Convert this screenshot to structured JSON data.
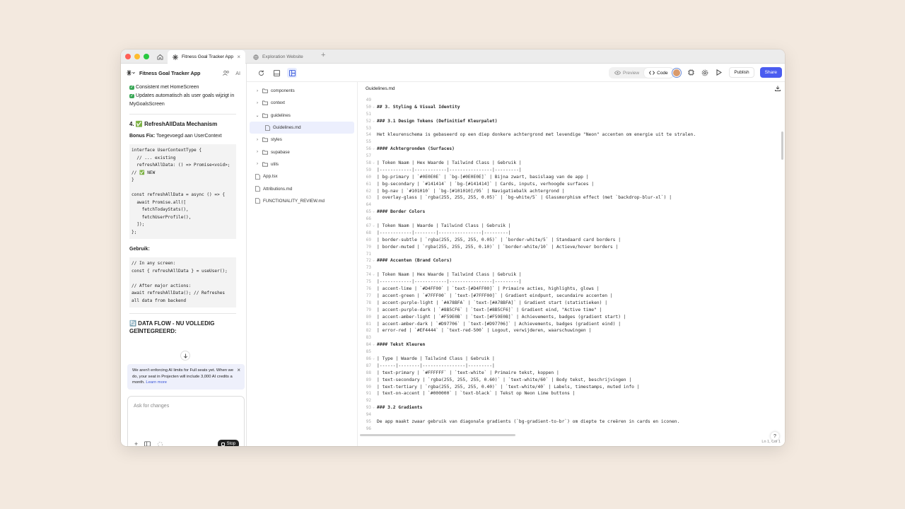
{
  "browser": {
    "tabs": [
      {
        "label": "Fitness Goal Tracker App",
        "close": "×"
      },
      {
        "label": "Exploration Website"
      }
    ],
    "new_tab": "+"
  },
  "left": {
    "project_name": "Fitness Goal Tracker App",
    "ai_badge": "AI",
    "chat": {
      "check_lines": [
        "Consistent met HomeScreen",
        "Updates automatisch als user goals wijzigt in MyGoalsScreen"
      ],
      "section4_title": "4. ✅ RefreshAllData Mechanism",
      "bonus_label": "Bonus Fix:",
      "bonus_text": " Toegevoegd aan UserContext",
      "code1": "interface UserContextType {\n  // ... existing\n  refreshAllData: () => Promise<void>;\n// ✅ NEW\n}\n\nconst refreshAllData = async () => {\n  await Promise.all([\n    fetchTodayStats(),\n    fetchUserProfile(),\n  ]);\n};",
      "usage_label": "Gebruik:",
      "code2": "// In any screen:\nconst { refreshAllData } = useUser();\n\n// After major actions:\nawait refreshAllData(); // Refreshes\nall data from backend",
      "dataflow_title": "🔄 DATA FLOW - NU VOLLEDIG GEÏNTEGREERD:"
    },
    "notice": {
      "text": "We aren't enforcing AI limits for Full seats yet. When we do, your seat in Projecten will include 3,000 AI credits a month.",
      "link": "Learn more"
    },
    "input": {
      "placeholder": "Ask for changes",
      "stop_label": "Stop"
    }
  },
  "toolbar": {
    "preview_label": "Preview",
    "code_label": "Code",
    "publish_label": "Publish",
    "share_label": "Share"
  },
  "tree": [
    {
      "label": "components",
      "type": "folder"
    },
    {
      "label": "context",
      "type": "folder"
    },
    {
      "label": "guidelines",
      "type": "folder-open"
    },
    {
      "label": "Guidelines.md",
      "type": "file",
      "selected": true
    },
    {
      "label": "styles",
      "type": "folder"
    },
    {
      "label": "supabase",
      "type": "folder"
    },
    {
      "label": "utils",
      "type": "folder"
    },
    {
      "label": "App.tsx",
      "type": "file"
    },
    {
      "label": "Attributions.md",
      "type": "file"
    },
    {
      "label": "FUNCTIONALITY_REVIEW.md",
      "type": "file"
    }
  ],
  "editor": {
    "filename": "Guidelines.md",
    "status": "Ln 1, Col 1",
    "lines": [
      {
        "n": "49",
        "t": ""
      },
      {
        "n": "50",
        "t": "## 3. Styling & Visual Identity",
        "b": true,
        "fold": true
      },
      {
        "n": "51",
        "t": ""
      },
      {
        "n": "52",
        "t": "### 3.1 Design Tokens (Definitief Kleurpalet)",
        "b": true,
        "fold": true
      },
      {
        "n": "53",
        "t": ""
      },
      {
        "n": "54",
        "t": "Het kleurenschema is gebaseerd op een diep donkere achtergrond met levendige \"Neon\" accenten om energie uit te stralen."
      },
      {
        "n": "55",
        "t": ""
      },
      {
        "n": "56",
        "t": "#### Achtergronden (Surfaces)",
        "b": true,
        "fold": true
      },
      {
        "n": "57",
        "t": ""
      },
      {
        "n": "58",
        "t": "| Token Naam | Hex Waarde | Tailwind Class | Gebruik |",
        "fold": true
      },
      {
        "n": "59",
        "t": "|------------|------------|----------------|---------|"
      },
      {
        "n": "60",
        "t": "| bg-primary | `#0E0E0E` | `bg-[#0E0E0E]` | Bijna zwart, basislaag van de app |"
      },
      {
        "n": "61",
        "t": "| bg-secondary | `#141414` | `bg-[#141414]` | Cards, inputs, verhoogde surfaces |"
      },
      {
        "n": "62",
        "t": "| bg-nav | `#101010` | `bg-[#101010]/95` | Navigatiebalk achtergrond |"
      },
      {
        "n": "63",
        "t": "| overlay-glass | `rgba(255, 255, 255, 0.05)` | `bg-white/5` | Glassmorphism effect (met `backdrop-blur-xl`) |"
      },
      {
        "n": "64",
        "t": ""
      },
      {
        "n": "65",
        "t": "#### Border Colors",
        "b": true,
        "fold": true
      },
      {
        "n": "66",
        "t": ""
      },
      {
        "n": "67",
        "t": "| Token Naam | Waarde | Tailwind Class | Gebruik |",
        "fold": true
      },
      {
        "n": "68",
        "t": "|------------|--------|----------------|---------|"
      },
      {
        "n": "69",
        "t": "| border-subtle | `rgba(255, 255, 255, 0.05)` | `border-white/5` | Standaard card borders |"
      },
      {
        "n": "70",
        "t": "| border-muted | `rgba(255, 255, 255, 0.10)` | `border-white/10` | Actieve/hover borders |"
      },
      {
        "n": "71",
        "t": ""
      },
      {
        "n": "72",
        "t": "#### Accenten (Brand Colors)",
        "b": true,
        "fold": true
      },
      {
        "n": "73",
        "t": ""
      },
      {
        "n": "74",
        "t": "| Token Naam | Hex Waarde | Tailwind Class | Gebruik |",
        "fold": true
      },
      {
        "n": "75",
        "t": "|------------|------------|----------------|---------|"
      },
      {
        "n": "76",
        "t": "| accent-lime | `#D4FF00` | `text-[#D4FF00]` | Primaire acties, highlights, glows |"
      },
      {
        "n": "77",
        "t": "| accent-green | `#7FFF00` | `text-[#7FFF00]` | Gradient eindpunt, secundaire accenten |"
      },
      {
        "n": "78",
        "t": "| accent-purple-light | `#A78BFA` | `text-[#A78BFA]` | Gradient start (statistieken) |"
      },
      {
        "n": "79",
        "t": "| accent-purple-dark | `#8B5CF6` | `text-[#8B5CF6]` | Gradient eind, \"Active time\" |"
      },
      {
        "n": "80",
        "t": "| accent-amber-light | `#F59E0B` | `text-[#F59E0B]` | Achievements, badges (gradient start) |"
      },
      {
        "n": "81",
        "t": "| accent-amber-dark | `#D97706` | `text-[#D97706]` | Achievements, badges (gradient eind) |"
      },
      {
        "n": "82",
        "t": "| error-red | `#EF4444` | `text-red-500` | Logout, verwijderen, waarschuwingen |"
      },
      {
        "n": "83",
        "t": ""
      },
      {
        "n": "84",
        "t": "#### Tekst Kleuren",
        "b": true,
        "fold": true
      },
      {
        "n": "85",
        "t": ""
      },
      {
        "n": "86",
        "t": "| Type | Waarde | Tailwind Class | Gebruik |",
        "fold": true
      },
      {
        "n": "87",
        "t": "|------|--------|----------------|---------|"
      },
      {
        "n": "88",
        "t": "| text-primary | `#FFFFFF` | `text-white` | Primaire tekst, koppen |"
      },
      {
        "n": "89",
        "t": "| text-secondary | `rgba(255, 255, 255, 0.60)` | `text-white/60` | Body tekst, beschrijvingen |"
      },
      {
        "n": "90",
        "t": "| text-tertiary | `rgba(255, 255, 255, 0.40)` | `text-white/40` | Labels, timestamps, muted info |"
      },
      {
        "n": "91",
        "t": "| text-on-accent | `#000000` | `text-black` | Tekst op Neon Lime buttons |"
      },
      {
        "n": "92",
        "t": ""
      },
      {
        "n": "93",
        "t": "### 3.2 Gradients",
        "b": true,
        "fold": true
      },
      {
        "n": "94",
        "t": ""
      },
      {
        "n": "95",
        "t": "De app maakt zwaar gebruik van diagonale gradients (`bg-gradient-to-br`) om diepte te creëren in cards en iconen."
      },
      {
        "n": "96",
        "t": ""
      }
    ]
  },
  "colors": {
    "accent": "#4a5cf0",
    "close": "#ff5f57",
    "minimize": "#febc2e",
    "zoom": "#28c840"
  },
  "help": "?"
}
